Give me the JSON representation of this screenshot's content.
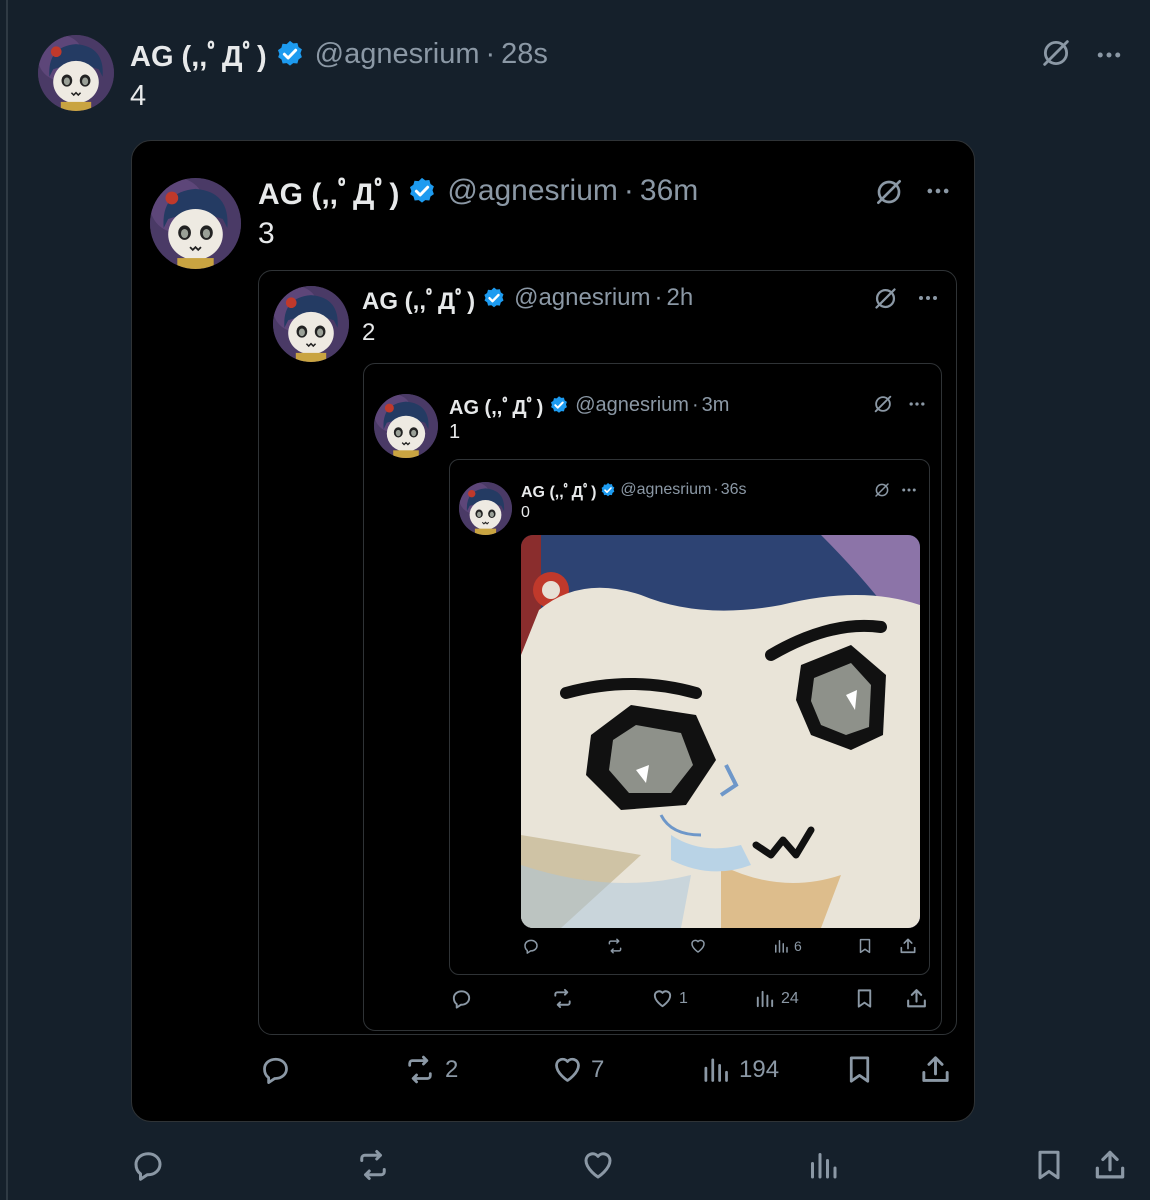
{
  "outer": {
    "name": "AG (,,ﾟДﾟ)",
    "handle": "@agnesrium",
    "sep": "·",
    "time": "28s",
    "text": "4",
    "actions": {
      "reply": "",
      "repost": "",
      "like": "",
      "views": ""
    }
  },
  "q3": {
    "name": "AG (,,ﾟДﾟ)",
    "handle": "@agnesrium",
    "sep": "·",
    "time": "36m",
    "text": "3",
    "actions": {
      "reply": "",
      "repost": "2",
      "like": "7",
      "views": "194"
    }
  },
  "q2": {
    "name": "AG (,,ﾟДﾟ)",
    "handle": "@agnesrium",
    "sep": "·",
    "time": "2h",
    "text": "2",
    "actions": {
      "reply": "",
      "repost": "",
      "like": "1",
      "views": "24"
    }
  },
  "q1": {
    "name": "AG (,,ﾟДﾟ)",
    "handle": "@agnesrium",
    "sep": "·",
    "time": "3m",
    "text": "1"
  },
  "q0": {
    "name": "AG (,,ﾟДﾟ)",
    "handle": "@agnesrium",
    "sep": "·",
    "time": "36s",
    "text": "0",
    "actions": {
      "reply": "",
      "repost": "",
      "like": "",
      "views": "6"
    }
  },
  "colors": {
    "background": "#15202b",
    "card": "#000000",
    "verified": "#1d9bf0",
    "muted": "#8b98a5",
    "text": "#e7e9ea"
  },
  "icons": [
    "verified-badge-icon",
    "grok-icon",
    "more-icon",
    "reply-icon",
    "repost-icon",
    "like-icon",
    "views-icon",
    "bookmark-icon",
    "share-icon"
  ]
}
